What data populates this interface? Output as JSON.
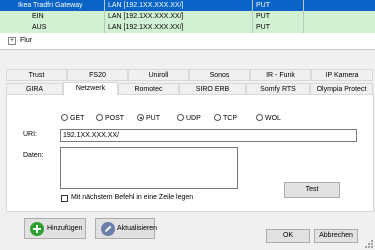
{
  "tree": {
    "rows": [
      {
        "name": "Ikea Tradfri Gateway",
        "address": "LAN [192.1XX.XXX.XX/]",
        "method": "PUT"
      },
      {
        "name": "EIN",
        "address": "LAN [192.1XX.XXX.XX/]",
        "method": "PUT"
      },
      {
        "name": "AUS",
        "address": "LAN [192.1XX.XXX.XX/]",
        "method": "PUT"
      }
    ],
    "group": {
      "expander": "+",
      "label": "Flur"
    }
  },
  "tabs": {
    "row1": [
      "Trust",
      "FS20",
      "Uniroll",
      "Sonos",
      "IR - Funk",
      "IP Kamera"
    ],
    "row2": [
      "GIRA",
      "Netzwerk",
      "Romotec",
      "SIRO ERB",
      "Somfy RTS",
      "Olympia Protect"
    ],
    "active": "Netzwerk"
  },
  "form": {
    "methods": [
      "GET",
      "POST",
      "PUT",
      "UDP",
      "TCP",
      "WOL"
    ],
    "selected_method": "PUT",
    "uri_label": "URI:",
    "uri_value": "192.1XX.XXX.XX/",
    "daten_label": "Daten:",
    "daten_value": "",
    "test_button": "Test",
    "checkbox_label": "Mit nächstem Befehl in eine Zeile legen",
    "checkbox_checked": false
  },
  "footer": {
    "add_button": "Hinzufügen",
    "update_button": "Aktualisieren",
    "ok_button": "OK",
    "cancel_button": "Abbrechen"
  },
  "colors": {
    "selection": "#0a64c8",
    "row_green": "#d2f0d2",
    "add_icon": "#2e9e2e",
    "edit_icon": "#6c7fa8"
  },
  "icons": {
    "add": "plus-circle-icon",
    "update": "pencil-icon",
    "resize": "resize-grip-icon"
  }
}
